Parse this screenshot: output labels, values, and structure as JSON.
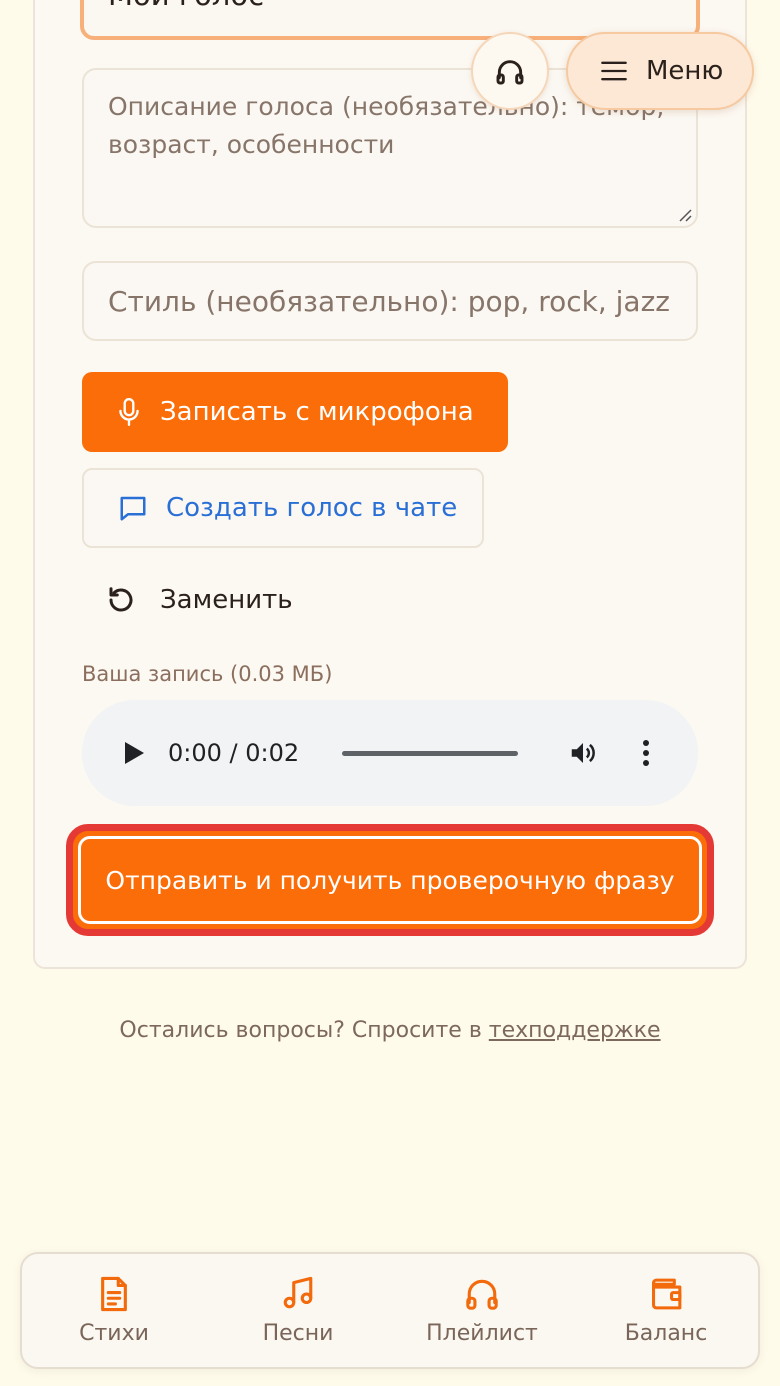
{
  "form": {
    "name_value": "Мой голос",
    "description_placeholder": "Описание голоса (необязательно): тембр, возраст, особенности",
    "style_placeholder": "Стиль (необязательно): pop, rock, jazz",
    "record_button": "Записать с микрофона",
    "chat_button": "Создать голос в чате",
    "replace_button": "Заменить",
    "recording_label": "Ваша запись (0.03 МБ)",
    "player_time": "0:00 / 0:02",
    "submit_button": "Отправить и получить проверочную фразу"
  },
  "help": {
    "text": "Остались вопросы? Спросите в ",
    "link": "техподдержке"
  },
  "header": {
    "menu_label": "Меню"
  },
  "bottom_nav": {
    "items": [
      {
        "label": "Стихи",
        "icon": "document-icon"
      },
      {
        "label": "Песни",
        "icon": "music-note-icon"
      },
      {
        "label": "Плейлист",
        "icon": "headphones-icon"
      },
      {
        "label": "Баланс",
        "icon": "wallet-icon"
      }
    ]
  },
  "colors": {
    "accent": "#fb6d08",
    "highlight_border": "#e53935",
    "link_blue": "#2a6fd6",
    "background": "#fffbeb"
  }
}
